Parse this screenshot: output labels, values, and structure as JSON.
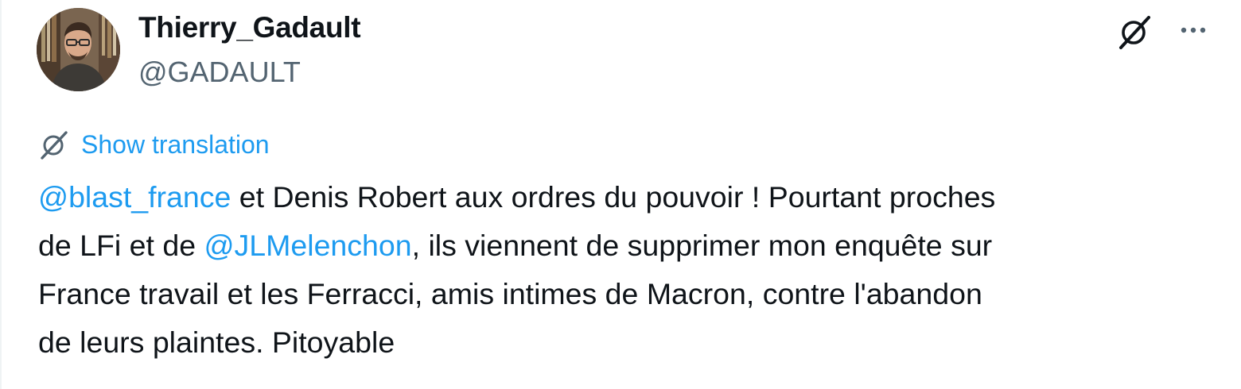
{
  "author": {
    "display_name": "Thierry_Gadault",
    "handle": "@GADAULT"
  },
  "header_actions": {
    "grok_icon": "grok-icon",
    "more_icon": "more-icon"
  },
  "translation": {
    "label": "Show translation",
    "icon": "grok-icon"
  },
  "tweet": {
    "mention_1": "@blast_france",
    "line_1_rest": " et Denis Robert aux ordres du pouvoir ! Pourtant proches",
    "line_2_start": "de LFi et de ",
    "mention_2": "@JLMelenchon",
    "line_2_rest": ", ils viennent de supprimer mon enquête sur",
    "line_3": "France travail et les Ferracci, amis intimes de Macron, contre l'abandon",
    "line_4": "de leurs plaintes. Pitoyable"
  },
  "colors": {
    "link": "#1d9bf0",
    "text": "#0f1419",
    "secondary": "#536471"
  }
}
